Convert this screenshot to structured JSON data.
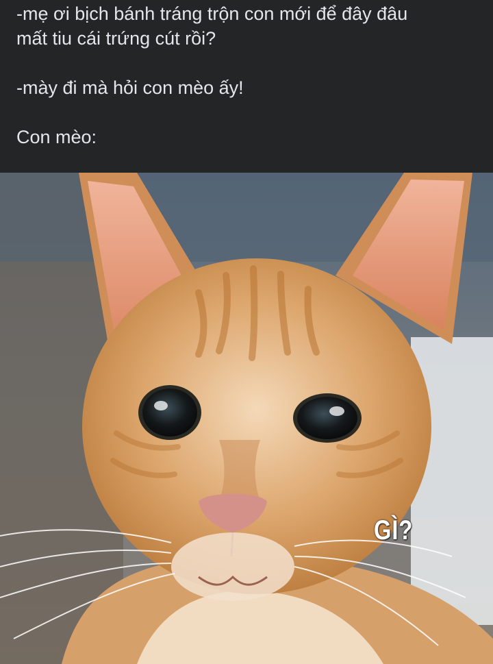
{
  "post": {
    "lines": [
      "-mẹ ơi bịch bánh tráng trộn con mới để đây đâu",
      "mất tiu cái trứng cút rồi?",
      "-mày đi mà hỏi con mèo ấy!",
      "Con mèo:"
    ]
  },
  "photo": {
    "caption": "GÌ?",
    "colors": {
      "fur": "#d79a5c",
      "ear_inner": "#e8a08a",
      "nose": "#d08f86",
      "background": "#4f5e6e"
    }
  }
}
